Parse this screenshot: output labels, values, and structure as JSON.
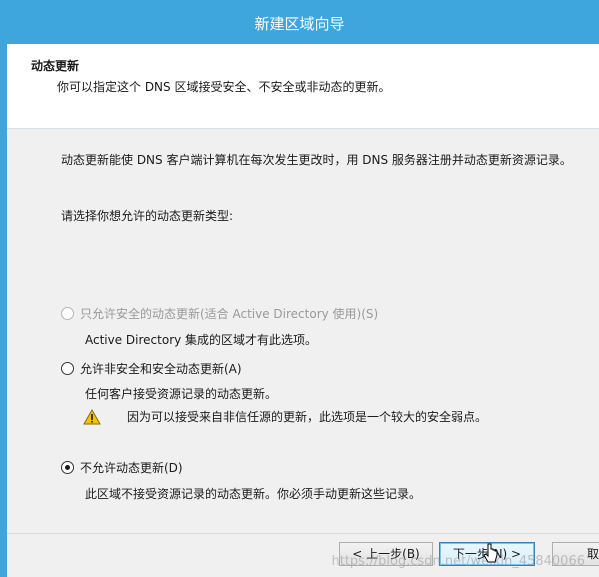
{
  "window": {
    "title": "新建区域向导"
  },
  "header": {
    "title": "动态更新",
    "subtitle": "你可以指定这个 DNS 区域接受安全、不安全或非动态的更新。"
  },
  "main": {
    "description": "动态更新能使 DNS 客户端计算机在每次发生更改时，用 DNS 服务器注册并动态更新资源记录。",
    "prompt": "请选择你想允许的动态更新类型:",
    "options": [
      {
        "label": "只允许安全的动态更新(适合 Active Directory 使用)(S)",
        "description": "Active Directory 集成的区域才有此选项。",
        "enabled": false,
        "selected": false
      },
      {
        "label": "允许非安全和安全动态更新(A)",
        "description": "任何客户接受资源记录的动态更新。",
        "warning": "因为可以接受来自非信任源的更新，此选项是一个较大的安全弱点。",
        "enabled": true,
        "selected": false
      },
      {
        "label": "不允许动态更新(D)",
        "description": "此区域不接受资源记录的动态更新。你必须手动更新这些记录。",
        "enabled": true,
        "selected": true
      }
    ]
  },
  "footer": {
    "back_label": "< 上一步(B)",
    "next_label": "下一步(N) >",
    "cancel_label": "取"
  },
  "icons": {
    "warning": "warning-icon",
    "cursor": "mouse-cursor-icon"
  },
  "colors": {
    "titlebar": "#3fa6dd",
    "warning_fill": "#f5c400"
  },
  "watermark": "https://blog.csdn.net/weixin_45840066"
}
